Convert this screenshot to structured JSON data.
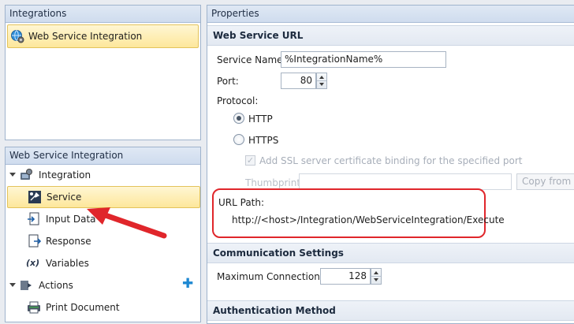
{
  "integrations_panel": {
    "title": "Integrations",
    "items": [
      {
        "label": "Web Service Integration",
        "selected": true
      }
    ]
  },
  "tree_panel": {
    "title": "Web Service Integration",
    "nodes": [
      {
        "label": "Integration",
        "icon": "integration-icon",
        "expanded": true
      },
      {
        "label": "Service",
        "icon": "service-icon",
        "selected": true
      },
      {
        "label": "Input Data",
        "icon": "input-data-icon"
      },
      {
        "label": "Response",
        "icon": "response-icon"
      },
      {
        "label": "Variables",
        "icon": "variables-icon",
        "icon_text": "(x)"
      },
      {
        "label": "Actions",
        "icon": "actions-icon",
        "expanded": true,
        "add_symbol": "✚"
      },
      {
        "label": "Print Document",
        "icon": "printer-icon"
      }
    ]
  },
  "properties": {
    "title": "Properties",
    "web_service_url": {
      "section_title": "Web Service URL",
      "service_name_label": "Service Name:",
      "service_name_value": "%IntegrationName%",
      "port_label": "Port:",
      "port_value": "80",
      "protocol_label": "Protocol:",
      "protocols": [
        {
          "label": "HTTP",
          "selected": true
        },
        {
          "label": "HTTPS",
          "selected": false
        }
      ],
      "ssl_checkbox_label": "Add SSL server certificate binding for the specified port",
      "ssl_checkbox_mark": "✓",
      "thumbprint_label": "Thumbprint:",
      "thumbprint_value": "",
      "copy_button_label": "Copy from a",
      "url_path_label": "URL Path:",
      "url_path_value": "http://<host>/Integration/WebServiceIntegration/Execute"
    },
    "communication_settings": {
      "section_title": "Communication Settings",
      "max_connections_label": "Maximum Connections:",
      "max_connections_value": "128"
    },
    "authentication_method": {
      "section_title": "Authentication Method"
    }
  },
  "colors": {
    "selection": "#fde79b",
    "accent_red": "#e0262b",
    "panel_header": "#cfdcee",
    "add_plus": "#1e88d2"
  }
}
